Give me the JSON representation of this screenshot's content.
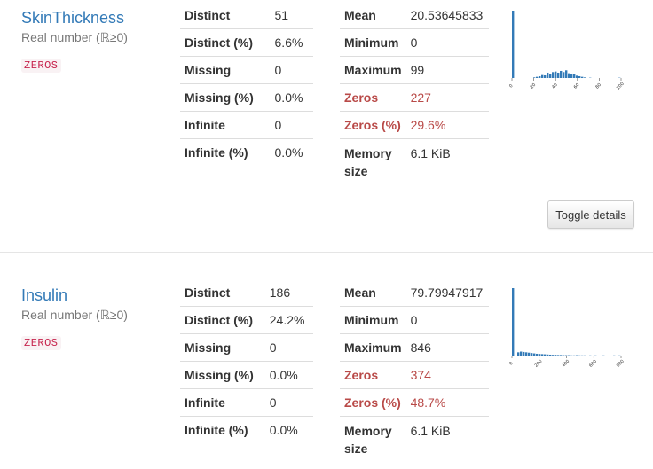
{
  "variables": [
    {
      "name": "SkinThickness",
      "type": "Real number (ℝ≥0)",
      "badge": "ZEROS",
      "stats_left": [
        {
          "label": "Distinct",
          "value": "51"
        },
        {
          "label": "Distinct (%)",
          "value": "6.6%"
        },
        {
          "label": "Missing",
          "value": "0"
        },
        {
          "label": "Missing (%)",
          "value": "0.0%"
        },
        {
          "label": "Infinite",
          "value": "0"
        },
        {
          "label": "Infinite (%)",
          "value": "0.0%"
        }
      ],
      "stats_right": [
        {
          "label": "Mean",
          "value": "20.53645833"
        },
        {
          "label": "Minimum",
          "value": "0"
        },
        {
          "label": "Maximum",
          "value": "99"
        },
        {
          "label": "Zeros",
          "value": "227"
        },
        {
          "label": "Zeros (%)",
          "value": "29.6%"
        },
        {
          "label": "Memory size",
          "value": "6.1 KiB"
        }
      ],
      "histogram": {
        "tick_labels": [
          "0",
          "20",
          "40",
          "60",
          "80",
          "100"
        ],
        "counts": [
          227,
          0,
          0,
          0,
          0,
          0,
          0,
          0,
          2,
          4,
          6,
          10,
          9,
          18,
          14,
          20,
          22,
          18,
          24,
          20,
          26,
          16,
          14,
          12,
          8,
          6,
          4,
          2,
          0,
          1,
          0,
          0,
          0,
          0,
          0,
          0,
          0,
          0,
          0,
          0,
          1
        ]
      }
    },
    {
      "name": "Insulin",
      "type": "Real number (ℝ≥0)",
      "badge": "ZEROS",
      "stats_left": [
        {
          "label": "Distinct",
          "value": "186"
        },
        {
          "label": "Distinct (%)",
          "value": "24.2%"
        },
        {
          "label": "Missing",
          "value": "0"
        },
        {
          "label": "Missing (%)",
          "value": "0.0%"
        },
        {
          "label": "Infinite",
          "value": "0"
        },
        {
          "label": "Infinite (%)",
          "value": "0.0%"
        }
      ],
      "stats_right": [
        {
          "label": "Mean",
          "value": "79.79947917"
        },
        {
          "label": "Minimum",
          "value": "0"
        },
        {
          "label": "Maximum",
          "value": "846"
        },
        {
          "label": "Zeros",
          "value": "374"
        },
        {
          "label": "Zeros (%)",
          "value": "48.7%"
        },
        {
          "label": "Memory size",
          "value": "6.1 KiB"
        }
      ],
      "histogram": {
        "tick_labels": [
          "0",
          "200",
          "400",
          "600",
          "800"
        ],
        "counts": [
          374,
          0,
          18,
          22,
          20,
          18,
          16,
          14,
          12,
          10,
          9,
          8,
          7,
          6,
          5,
          4,
          4,
          3,
          3,
          2,
          2,
          2,
          1,
          1,
          2,
          1,
          1,
          1,
          0,
          1,
          0,
          1,
          0,
          0,
          1,
          0,
          0,
          0,
          1,
          0,
          1
        ]
      }
    }
  ],
  "toggle_label": "Toggle details"
}
